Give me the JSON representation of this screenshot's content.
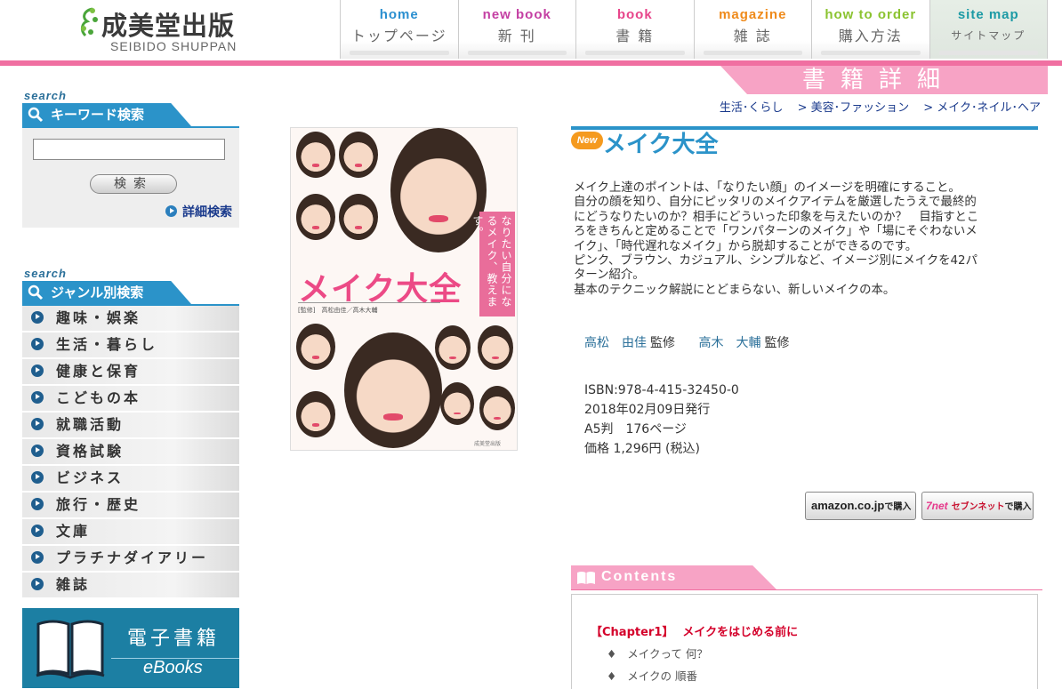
{
  "header": {
    "logo_jp": "成美堂出版",
    "logo_en": "SEIBIDO SHUPPAN",
    "nav": [
      {
        "en": "home",
        "jp": "トップページ",
        "color": "#2a8fd0"
      },
      {
        "en": "new book",
        "jp": "新 刊",
        "color": "#c43fa3"
      },
      {
        "en": "book",
        "jp": "書 籍",
        "color": "#e7458a"
      },
      {
        "en": "magazine",
        "jp": "雑 誌",
        "color": "#ef8a1a"
      },
      {
        "en": "how to order",
        "jp": "購入方法",
        "color": "#8bc330"
      },
      {
        "en": "site map",
        "jp": "サイトマップ",
        "color": "#1c9aa5"
      }
    ]
  },
  "banner": {
    "title": "書籍詳細"
  },
  "breadcrumb": [
    "生活･くらし",
    "> 美容･ファッション",
    "> メイク･ネイル･ヘア"
  ],
  "sidebar": {
    "search_small": "search",
    "keyword_title": "キーワード検索",
    "keyword_value": "",
    "search_button": "検索",
    "advanced_link": "詳細検索",
    "genre_small": "search",
    "genre_title": "ジャンル別検索",
    "genres": [
      "趣味・娯楽",
      "生活・暮らし",
      "健康と保育",
      "こどもの本",
      "就職活動",
      "資格試験",
      "ビジネス",
      "旅行・歴史",
      "文庫",
      "プラチナダイアリー",
      "雑誌"
    ],
    "ebooks_jp": "電子書籍",
    "ebooks_en": "eBooks"
  },
  "cover": {
    "title": "メイク大全",
    "catch": "なりたい自分になるメイク、教えます。",
    "authors": "[監修]　高松由佳／高木大輔",
    "publisher": "成美堂出版"
  },
  "book": {
    "badge": "New",
    "title": "メイク大全",
    "description": [
      "メイク上達のポイントは、「なりたい顔」のイメージを明確にすること。",
      "自分の顔を知り、自分にピッタリのメイクアイテムを厳選したうえで最終的",
      "にどうなりたいのか？相手にどういった印象を与えたいのか？　目指すとこ",
      "ろをきちんと定めることで「ワンパターンのメイク」や「場にそぐわないメ",
      "イク」、「時代遅れなメイク」から脱却することができるのです。",
      "ピンク、ブラウン、カジュアル、シンプルなど、イメージ別にメイクを42パ",
      "ターン紹介。",
      "基本のテクニック解説にとどまらない、新しいメイクの本。"
    ],
    "authors": [
      {
        "name": "高松　由佳",
        "role": "監修"
      },
      {
        "name": "高木　大輔",
        "role": "監修"
      }
    ],
    "isbn": "ISBN:978-4-415-32450-0",
    "date": "2018年02月09日発行",
    "format": "A5判　176ページ",
    "price": "価格 1,296円 (税込)",
    "buy_amazon_logo": "amazon.co.jp",
    "buy_amazon_label": "で購入",
    "buy_seven_logo": "7net",
    "buy_seven_name": "セブンネット",
    "buy_seven_label": "で購入"
  },
  "contents": {
    "title": "Contents",
    "chapter1_no": "【Chapter1】",
    "chapter1_title": "メイクをはじめる前に",
    "items": [
      "メイクって 何？",
      "メイクの 順番"
    ]
  }
}
